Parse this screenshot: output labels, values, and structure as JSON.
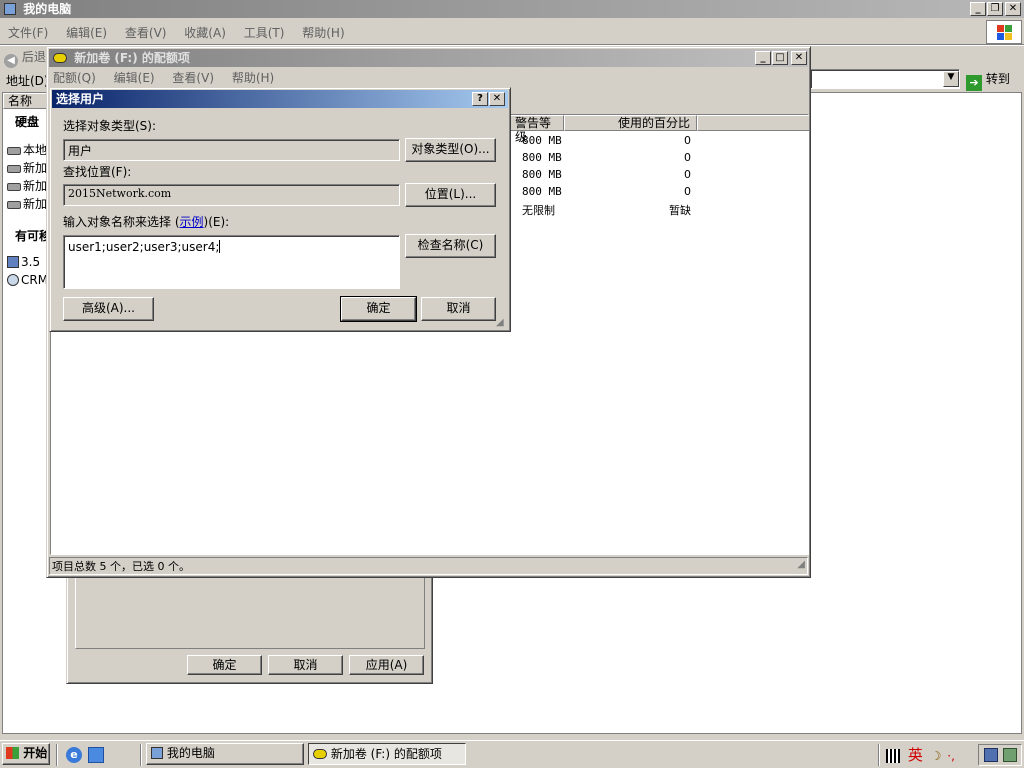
{
  "main_window": {
    "title": "我的电脑",
    "menu": [
      "文件(F)",
      "编辑(E)",
      "查看(V)",
      "收藏(A)",
      "工具(T)",
      "帮助(H)"
    ],
    "back_label": "后退",
    "address_label": "地址(D)",
    "go_label": "转到",
    "name_col": "名称",
    "section_hard_disk": "硬盘",
    "section_removable": "有可移",
    "drives": [
      "本地",
      "新加",
      "新加",
      "新加"
    ],
    "removable": [
      "3.5",
      "CRM"
    ]
  },
  "properties_dialog": {
    "buttons": {
      "ok": "确定",
      "cancel": "取消",
      "apply": "应用(A)"
    }
  },
  "quota_window": {
    "title": "新加卷 (F:) 的配额项",
    "menu": [
      "配额(Q)",
      "编辑(E)",
      "查看(V)",
      "帮助(H)"
    ],
    "columns": [
      "警告等级",
      "使用的百分比"
    ],
    "rows": [
      {
        "warning": "800 MB",
        "percent": "0"
      },
      {
        "warning": "800 MB",
        "percent": "0"
      },
      {
        "warning": "800 MB",
        "percent": "0"
      },
      {
        "warning": "800 MB",
        "percent": "0"
      },
      {
        "warning": "无限制",
        "percent": "暂缺"
      }
    ],
    "status": "项目总数 5 个，已选 0 个。"
  },
  "select_user_dialog": {
    "title": "选择用户",
    "object_type_label": "选择对象类型(S):",
    "object_type_value": "用户",
    "object_type_button": "对象类型(O)...",
    "location_label": "查找位置(F):",
    "location_value": "2015Network.com",
    "location_button": "位置(L)...",
    "names_label_pre": "输入对象名称来选择 (",
    "names_label_link": "示例",
    "names_label_post": ")(E):",
    "names_value": "user1;user2;user3;user4;",
    "check_names_button": "检查名称(C)",
    "advanced_button": "高级(A)...",
    "ok_button": "确定",
    "cancel_button": "取消"
  },
  "taskbar": {
    "start": "开始",
    "tasks": [
      "我的电脑",
      "新加卷 (F:) 的配额项"
    ],
    "tray_ime": "英"
  }
}
